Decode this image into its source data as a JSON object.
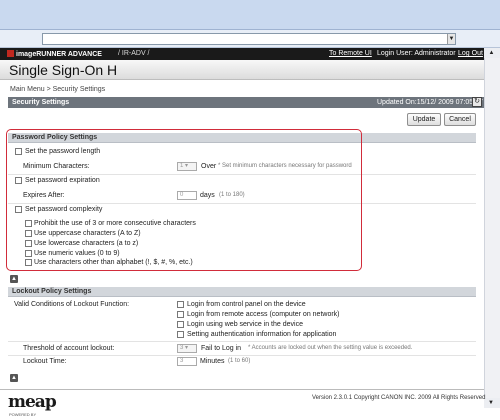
{
  "header": {
    "brand": "imageRUNNER ADVANCE",
    "device": "/ IR-ADV /",
    "remote_ui": "To Remote UI",
    "login_user": "Login User: Administrator",
    "logout": "Log Out"
  },
  "page_title": "Single Sign-On H",
  "breadcrumb": "Main Menu > Security Settings",
  "section": {
    "title": "Security Settings",
    "updated": "Updated On:15/12/ 2009 07:05:37"
  },
  "buttons": {
    "update": "Update",
    "cancel": "Cancel"
  },
  "password_policy": {
    "title": "Password Policy Settings",
    "set_length": "Set the password length",
    "min_chars_label": "Minimum Characters:",
    "min_chars_value": "1",
    "min_chars_unit": "Over",
    "min_chars_note": "* Set minimum characters necessary for password",
    "set_expiration": "Set password expiration",
    "expires_label": "Expires After:",
    "expires_value": "0",
    "expires_unit": "days",
    "expires_range": "(1 to 180)",
    "set_complexity": "Set password complexity",
    "complexity_options": [
      "Prohibit the use of 3 or more consecutive characters",
      "Use uppercase characters (A to Z)",
      "Use lowercase characters (a to z)",
      "Use numeric values (0 to 9)",
      "Use characters other than alphabet (!, $, #, %, etc.)"
    ]
  },
  "lockout_policy": {
    "title": "Lockout Policy Settings",
    "conditions_label": "Valid Conditions of Lockout Function:",
    "conditions": [
      "Login from control panel on the device",
      "Login from remote access (computer on network)",
      "Login using web service in the device",
      "Setting authentication information for application"
    ],
    "threshold_label": "Threshold of account lockout:",
    "threshold_value": "3",
    "threshold_unit": "Fail to Log in",
    "threshold_note": "* Accounts are locked out when the setting value is exceeded.",
    "lockout_time_label": "Lockout Time:",
    "lockout_time_value": "3",
    "lockout_time_unit": "Minutes",
    "lockout_time_range": "(1 to 60)"
  },
  "footer": {
    "logo": "meap",
    "logo_sub": "POWERED BY",
    "version": "Version 2.3.0.1 Copyright CANON INC. 2009 All Rights Reserved"
  },
  "colors": {
    "highlight": "#d12c3a",
    "header_bg": "#1a1a1a",
    "section_bar": "#6d747c"
  }
}
